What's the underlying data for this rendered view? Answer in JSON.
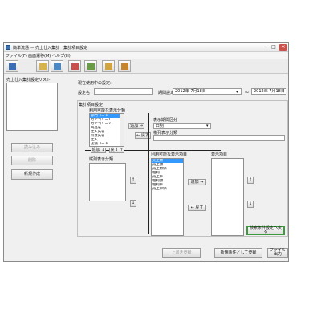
{
  "window": {
    "title": "簡単流通 － 売上仕入集計　集計項目設定",
    "minimize": "−",
    "maximize": "□",
    "close": "×"
  },
  "menu": [
    "ファイル(F)",
    "画面遷移(M)",
    "ヘルプ(H)"
  ],
  "toolbar": {
    "buttons": [
      {
        "icon": "list-icon",
        "color": "#3b6db5"
      },
      {
        "icon": "document-icon",
        "color": "#d8b24a"
      },
      {
        "icon": "chart-icon",
        "color": "#4a88c8"
      },
      {
        "icon": "report-icon",
        "color": "#c94f4f"
      },
      {
        "icon": "gear-icon",
        "color": "#6a9c43"
      },
      {
        "icon": "folder-icon",
        "color": "#d1a341"
      },
      {
        "icon": "flow-icon",
        "color": "#c7842f"
      }
    ]
  },
  "left_panel": {
    "list_title": "売上仕入集計設定リスト",
    "load_button": "読み込み",
    "delete_button": "削除",
    "new_button": "新規作成"
  },
  "current": {
    "label": "現在使用中の設定:",
    "setting_name_label": "設定名",
    "setting_name_value": "",
    "period_label": "期間設定",
    "date_from": "2012年  7月18日",
    "tilde": "～",
    "date_to": "2012年  7月18日",
    "dropdown_arrow": "▾"
  },
  "config": {
    "group_title": "集計項目設定",
    "available_display_label": "利用可能な表示分類",
    "available_display_items": [
      "部門コード",
      "カテゴリー1",
      "カテゴリー2",
      "商品名",
      "仕入先名",
      "得意先名",
      "仕入",
      "店舗コード"
    ],
    "add_button": "追加 →",
    "back_button": "← 戻す",
    "display_period_label": "表示期間区分",
    "display_period_value": "日別",
    "horizontal_display_label": "横列表示分類",
    "horizontal_display_value": "",
    "add_small": "追加 ↓",
    "back_small": "戻す ↑",
    "vertical_display_label": "縦列表示分類",
    "up_arrow": "↑",
    "down_arrow": "↓",
    "available_items_label": "利用可能な表示項目",
    "available_items": [
      "売上数",
      "売上額",
      "売上原価",
      "粗利",
      "売上率",
      "粗利額",
      "粗利率",
      "売上単価"
    ],
    "display_items_label": "表示項目",
    "add_items_button": "追加 →",
    "back_items_button": "← 戻す",
    "back_to_search_button": "検索条件設定へ戻る"
  },
  "footer": {
    "overwrite_button": "上書き登録",
    "save_new_button": "新規条件として登録",
    "export_button": "ファイル出力"
  }
}
